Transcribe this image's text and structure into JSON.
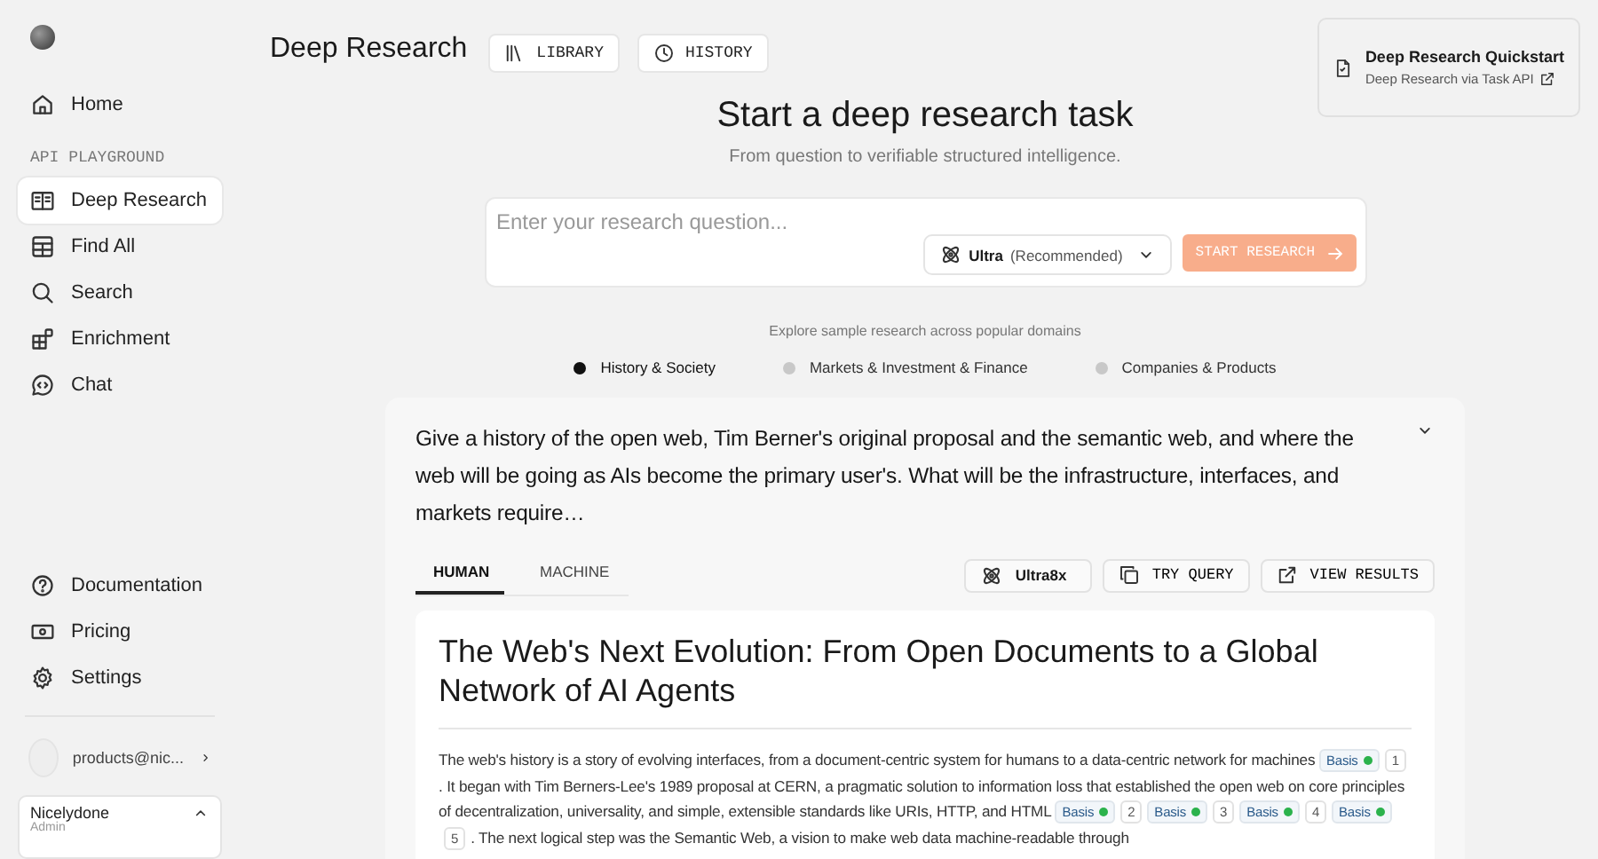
{
  "sidebar": {
    "home": {
      "label": "Home",
      "selected": false
    },
    "section_label": "API PLAYGROUND",
    "playground_items": [
      {
        "label": "Deep Research",
        "selected": true
      },
      {
        "label": "Find All",
        "selected": false
      },
      {
        "label": "Search",
        "selected": false
      },
      {
        "label": "Enrichment",
        "selected": false
      },
      {
        "label": "Chat",
        "selected": false
      }
    ],
    "bottom_items": [
      {
        "label": "Documentation"
      },
      {
        "label": "Pricing"
      },
      {
        "label": "Settings"
      }
    ],
    "account": {
      "email": "products@nic...",
      "org": "Nicelydone",
      "role": "Admin"
    }
  },
  "header": {
    "title": "Deep Research",
    "buttons": [
      {
        "label": "LIBRARY"
      },
      {
        "label": "HISTORY"
      }
    ],
    "quickstart": {
      "title": "Deep Research Quickstart",
      "link": "Deep Research via Task API"
    }
  },
  "hero": {
    "title": "Start a deep research task",
    "subtitle": "From question to verifiable structured intelligence."
  },
  "query_box": {
    "placeholder": "Enter your research question...",
    "model": {
      "name": "Ultra",
      "note": "(Recommended)"
    },
    "submit": {
      "label": "START RESEARCH",
      "disabled": true
    }
  },
  "samples": {
    "label": "Explore sample research across popular domains",
    "domains": [
      {
        "label": "History & Society",
        "selected": true
      },
      {
        "label": "Markets & Investment & Finance",
        "selected": false
      },
      {
        "label": "Companies & Products",
        "selected": false
      }
    ]
  },
  "example": {
    "question": "Give a history of the open web, Tim Berner's original proposal and the semantic web, and where the web will be going as AIs become the primary user's. What will be the infrastructure, interfaces, and markets require…",
    "tabs": [
      {
        "label": "HUMAN",
        "selected": true
      },
      {
        "label": "MACHINE",
        "selected": false
      }
    ],
    "model_chip": "Ultra8x",
    "actions": [
      {
        "label": "TRY QUERY"
      },
      {
        "label": "VIEW RESULTS"
      }
    ],
    "report": {
      "title": "The Web's Next Evolution: From Open Documents to a Global Network of AI Agents",
      "paragraph": [
        {
          "kind": "text",
          "text": "The web's history is a story of evolving interfaces, from a document-centric system for humans to a data-centric network for machines "
        },
        {
          "kind": "basis",
          "text": "Basis"
        },
        {
          "kind": "ref",
          "text": "1"
        },
        {
          "kind": "text",
          "text": ". It began with Tim Berners-Lee's 1989 proposal at CERN, a pragmatic solution to information loss that established the open web on core principles of decentralization, universality, and simple, extensible standards like URIs, HTTP, and HTML "
        },
        {
          "kind": "basis",
          "text": "Basis"
        },
        {
          "kind": "ref",
          "text": "2"
        },
        {
          "kind": "basis",
          "text": "Basis"
        },
        {
          "kind": "ref",
          "text": "3"
        },
        {
          "kind": "basis",
          "text": "Basis"
        },
        {
          "kind": "ref",
          "text": "4"
        },
        {
          "kind": "basis",
          "text": "Basis"
        },
        {
          "kind": "ref",
          "text": "5"
        },
        {
          "kind": "text",
          "text": ". The next logical step was the Semantic Web, a vision to make web data machine-readable through"
        }
      ]
    }
  }
}
